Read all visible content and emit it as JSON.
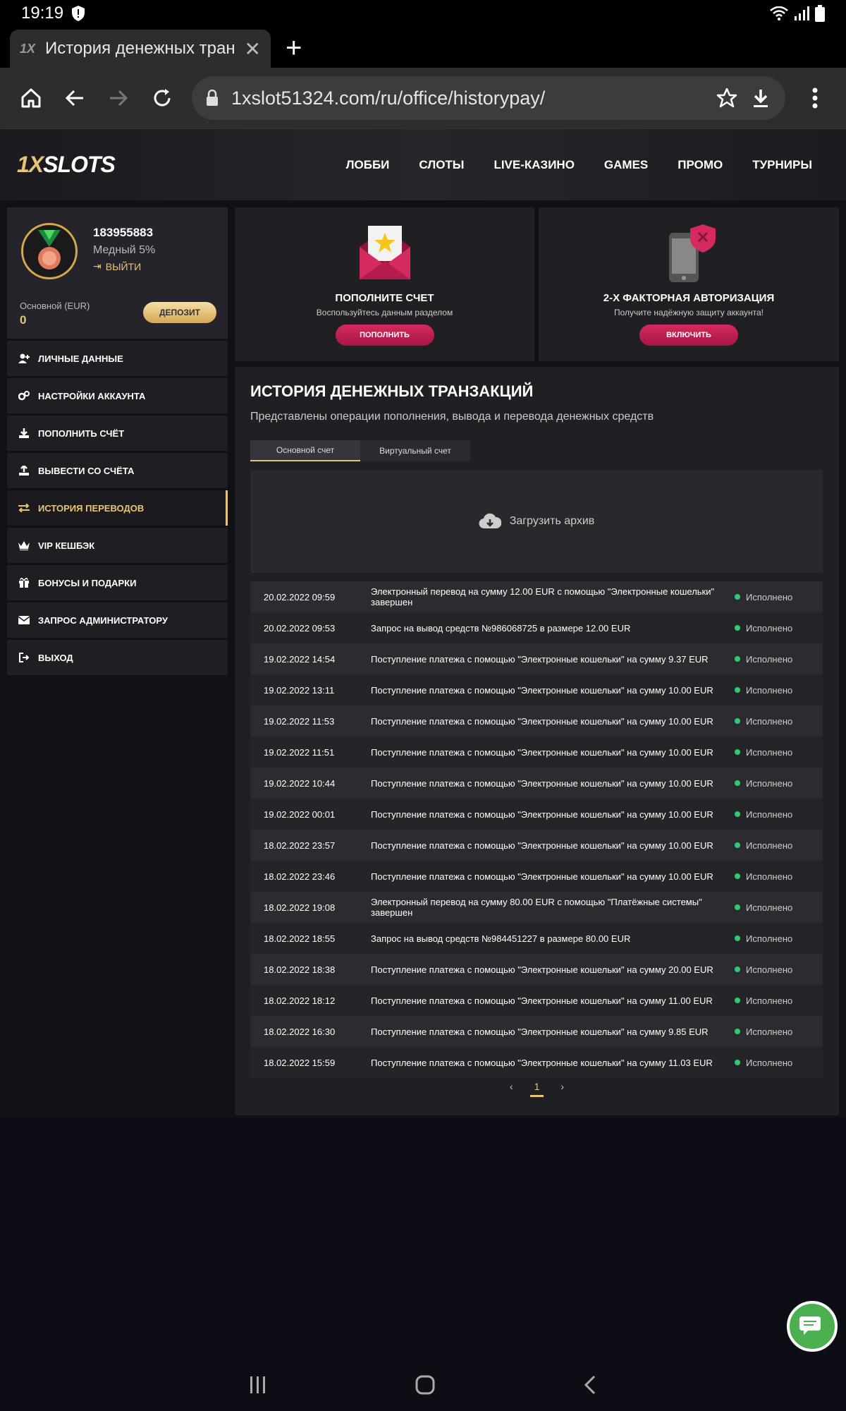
{
  "status": {
    "time": "19:19"
  },
  "browser": {
    "tab_title": "История денежных тран...",
    "tab_icon": "1X",
    "url": "1xslot51324.com/ru/office/historypay/"
  },
  "site": {
    "logo_one": "1X",
    "logo_slots": "SLOTS",
    "nav": [
      "ЛОББИ",
      "СЛОТЫ",
      "LIVE-КАЗИНО",
      "GAMES",
      "ПРОМО",
      "ТУРНИРЫ"
    ]
  },
  "profile": {
    "id": "183955883",
    "level": "Медный 5%",
    "logout": "ВЫЙТИ",
    "balance_label": "Основной (EUR)",
    "balance": "0",
    "deposit": "ДЕПОЗИТ"
  },
  "menu": [
    {
      "label": "ЛИЧНЫЕ ДАННЫЕ",
      "icon": "user-plus-icon"
    },
    {
      "label": "НАСТРОЙКИ АККАУНТА",
      "icon": "gears-icon"
    },
    {
      "label": "ПОПОЛНИТЬ СЧЁТ",
      "icon": "download-icon"
    },
    {
      "label": "ВЫВЕСТИ СО СЧЁТА",
      "icon": "upload-icon"
    },
    {
      "label": "ИСТОРИЯ ПЕРЕВОДОВ",
      "icon": "transfer-icon",
      "active": true
    },
    {
      "label": "VIP КЕШБЭК",
      "icon": "crown-icon"
    },
    {
      "label": "БОНУСЫ И ПОДАРКИ",
      "icon": "gift-icon"
    },
    {
      "label": "ЗАПРОС АДМИНИСТРАТОРУ",
      "icon": "envelope-icon"
    },
    {
      "label": "ВЫХОД",
      "icon": "exit-icon"
    }
  ],
  "cards": {
    "deposit": {
      "title": "ПОПОЛНИТЕ СЧЕТ",
      "sub": "Воспользуйтесь данным разделом",
      "btn": "ПОПОЛНИТЬ"
    },
    "twofa": {
      "title": "2-Х ФАКТОРНАЯ АВТОРИЗАЦИЯ",
      "sub": "Получите надёжную защиту аккаунта!",
      "btn": "ВКЛЮЧИТЬ"
    }
  },
  "history": {
    "title": "ИСТОРИЯ ДЕНЕЖНЫХ ТРАНЗАКЦИЙ",
    "subtitle": "Представлены операции пополнения, вывода и перевода денежных средств",
    "tabs": [
      "Основной счет",
      "Виртуальный счет"
    ],
    "archive": "Загрузить архив",
    "rows": [
      {
        "date": "20.02.2022 09:59",
        "desc": "Электронный перевод на сумму 12.00 EUR с помощью \"Электронные кошельки\" завершен",
        "status": "Исполнено"
      },
      {
        "date": "20.02.2022 09:53",
        "desc": "Запрос на вывод средств №986068725 в размере 12.00 EUR",
        "status": "Исполнено"
      },
      {
        "date": "19.02.2022 14:54",
        "desc": "Поступление платежа с помощью \"Электронные кошельки\" на сумму 9.37 EUR",
        "status": "Исполнено"
      },
      {
        "date": "19.02.2022 13:11",
        "desc": "Поступление платежа с помощью \"Электронные кошельки\" на сумму 10.00 EUR",
        "status": "Исполнено"
      },
      {
        "date": "19.02.2022 11:53",
        "desc": "Поступление платежа с помощью \"Электронные кошельки\" на сумму 10.00 EUR",
        "status": "Исполнено"
      },
      {
        "date": "19.02.2022 11:51",
        "desc": "Поступление платежа с помощью \"Электронные кошельки\" на сумму 10.00 EUR",
        "status": "Исполнено"
      },
      {
        "date": "19.02.2022 10:44",
        "desc": "Поступление платежа с помощью \"Электронные кошельки\" на сумму 10.00 EUR",
        "status": "Исполнено"
      },
      {
        "date": "19.02.2022 00:01",
        "desc": "Поступление платежа с помощью \"Электронные кошельки\" на сумму 10.00 EUR",
        "status": "Исполнено"
      },
      {
        "date": "18.02.2022 23:57",
        "desc": "Поступление платежа с помощью \"Электронные кошельки\" на сумму 10.00 EUR",
        "status": "Исполнено"
      },
      {
        "date": "18.02.2022 23:46",
        "desc": "Поступление платежа с помощью \"Электронные кошельки\" на сумму 10.00 EUR",
        "status": "Исполнено"
      },
      {
        "date": "18.02.2022 19:08",
        "desc": "Электронный перевод на сумму 80.00 EUR с помощью \"Платёжные системы\" завершен",
        "status": "Исполнено"
      },
      {
        "date": "18.02.2022 18:55",
        "desc": "Запрос на вывод средств №984451227 в размере 80.00 EUR",
        "status": "Исполнено"
      },
      {
        "date": "18.02.2022 18:38",
        "desc": "Поступление платежа с помощью \"Электронные кошельки\" на сумму 20.00 EUR",
        "status": "Исполнено"
      },
      {
        "date": "18.02.2022 18:12",
        "desc": "Поступление платежа с помощью \"Электронные кошельки\" на сумму 11.00 EUR",
        "status": "Исполнено"
      },
      {
        "date": "18.02.2022 16:30",
        "desc": "Поступление платежа с помощью \"Электронные кошельки\" на сумму 9.85 EUR",
        "status": "Исполнено"
      },
      {
        "date": "18.02.2022 15:59",
        "desc": "Поступление платежа с помощью \"Электронные кошельки\" на сумму 11.03 EUR",
        "status": "Исполнено"
      }
    ],
    "pager": {
      "prev": "‹",
      "current": "1",
      "next": "›"
    }
  },
  "colors": {
    "gold": "#e8c47a",
    "accent": "#c41f52",
    "success": "#2ecc71"
  }
}
